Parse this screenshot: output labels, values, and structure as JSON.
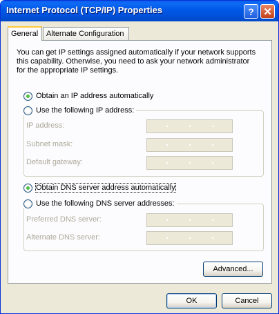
{
  "window": {
    "title": "Internet Protocol (TCP/IP) Properties"
  },
  "titlebar": {
    "help_glyph": "?",
    "close_glyph": "✕"
  },
  "tabs": [
    {
      "label": "General",
      "selected": true
    },
    {
      "label": "Alternate Configuration",
      "selected": false
    }
  ],
  "general": {
    "description": "You can get IP settings assigned automatically if your network supports this capability. Otherwise, you need to ask your network administrator for the appropriate IP settings.",
    "ip": {
      "auto_label": "Obtain an IP address automatically",
      "manual_label": "Use the following IP address:",
      "selected": "auto",
      "fields": [
        {
          "label": "IP address:",
          "value": ""
        },
        {
          "label": "Subnet mask:",
          "value": ""
        },
        {
          "label": "Default gateway:",
          "value": ""
        }
      ]
    },
    "dns": {
      "auto_label": "Obtain DNS server address automatically",
      "manual_label": "Use the following DNS server addresses:",
      "selected": "auto",
      "fields": [
        {
          "label": "Preferred DNS server:",
          "value": ""
        },
        {
          "label": "Alternate DNS server:",
          "value": ""
        }
      ]
    },
    "advanced_label": "Advanced..."
  },
  "footer": {
    "ok_label": "OK",
    "cancel_label": "Cancel"
  }
}
